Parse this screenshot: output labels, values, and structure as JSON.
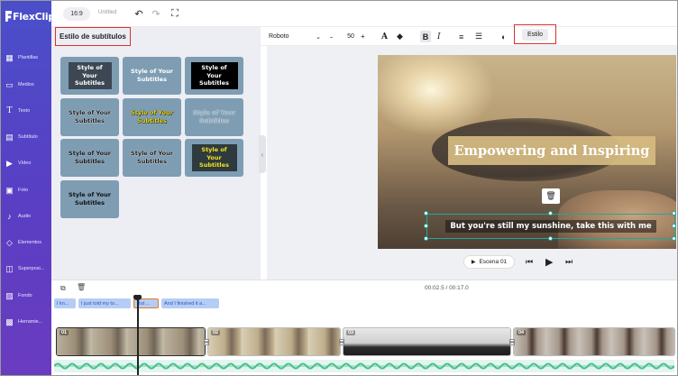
{
  "app": {
    "logo": "FlexClip",
    "aspect_ratio": "16:9",
    "project_title": "Untitled"
  },
  "sidebar": {
    "items": [
      {
        "label": "Plantillas",
        "icon": "templates-icon"
      },
      {
        "label": "Medios",
        "icon": "media-folder-icon"
      },
      {
        "label": "Texto",
        "icon": "text-icon"
      },
      {
        "label": "Subtítulo",
        "icon": "subtitle-icon"
      },
      {
        "label": "Vídeo",
        "icon": "video-icon"
      },
      {
        "label": "Foto",
        "icon": "photo-icon"
      },
      {
        "label": "Audio",
        "icon": "music-icon"
      },
      {
        "label": "Elementos",
        "icon": "elements-icon"
      },
      {
        "label": "Superposi...",
        "icon": "overlay-icon"
      },
      {
        "label": "Fondo",
        "icon": "background-icon"
      },
      {
        "label": "Herramie...",
        "icon": "tools-icon"
      }
    ]
  },
  "panel": {
    "title": "Estilo de subtítulos",
    "tile_text": "Style of Your Subtitles"
  },
  "format_bar": {
    "font": "Roboto",
    "font_size": "50",
    "minus": "-",
    "plus": "+",
    "style_button": "Estilo"
  },
  "canvas": {
    "headline": "Empowering and Inspiring",
    "subtitle": "But you're still my sunshine, take this with me"
  },
  "playback": {
    "scene_label": "Escena 01",
    "time": "00:02.5 / 00:17.0"
  },
  "timeline": {
    "subtitle_chips": [
      "I kn...",
      "I just told my to...",
      "But ...",
      "And I finished it a..."
    ],
    "clips": [
      "01",
      "02",
      "03",
      "04"
    ]
  }
}
